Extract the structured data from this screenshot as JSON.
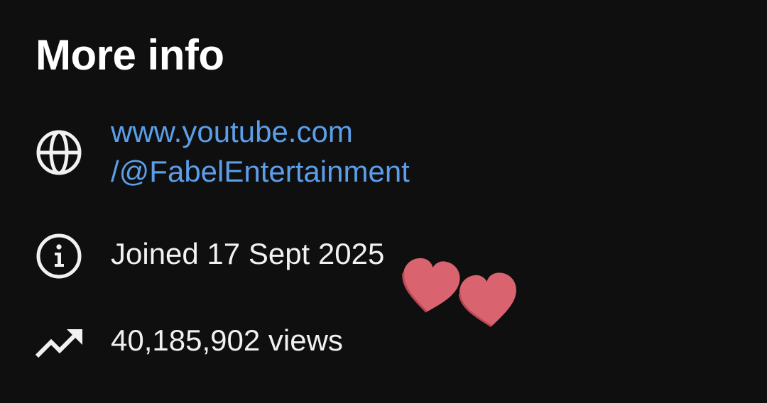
{
  "section": {
    "title": "More info"
  },
  "info_rows": {
    "link": {
      "icon": "globe-icon",
      "line1": "www.youtube.com",
      "line2": "/@FabelEntertainment"
    },
    "joined": {
      "icon": "info-icon",
      "text": "Joined 17 Sept 2025"
    },
    "views": {
      "icon": "trending-up-icon",
      "text": "40,185,902 views"
    }
  },
  "overlay": {
    "icon": "hearts-sticker",
    "color": "#d9636f"
  },
  "colors": {
    "background": "#0f0f0f",
    "link": "#5b9ee9",
    "text": "#f1f1f1"
  }
}
